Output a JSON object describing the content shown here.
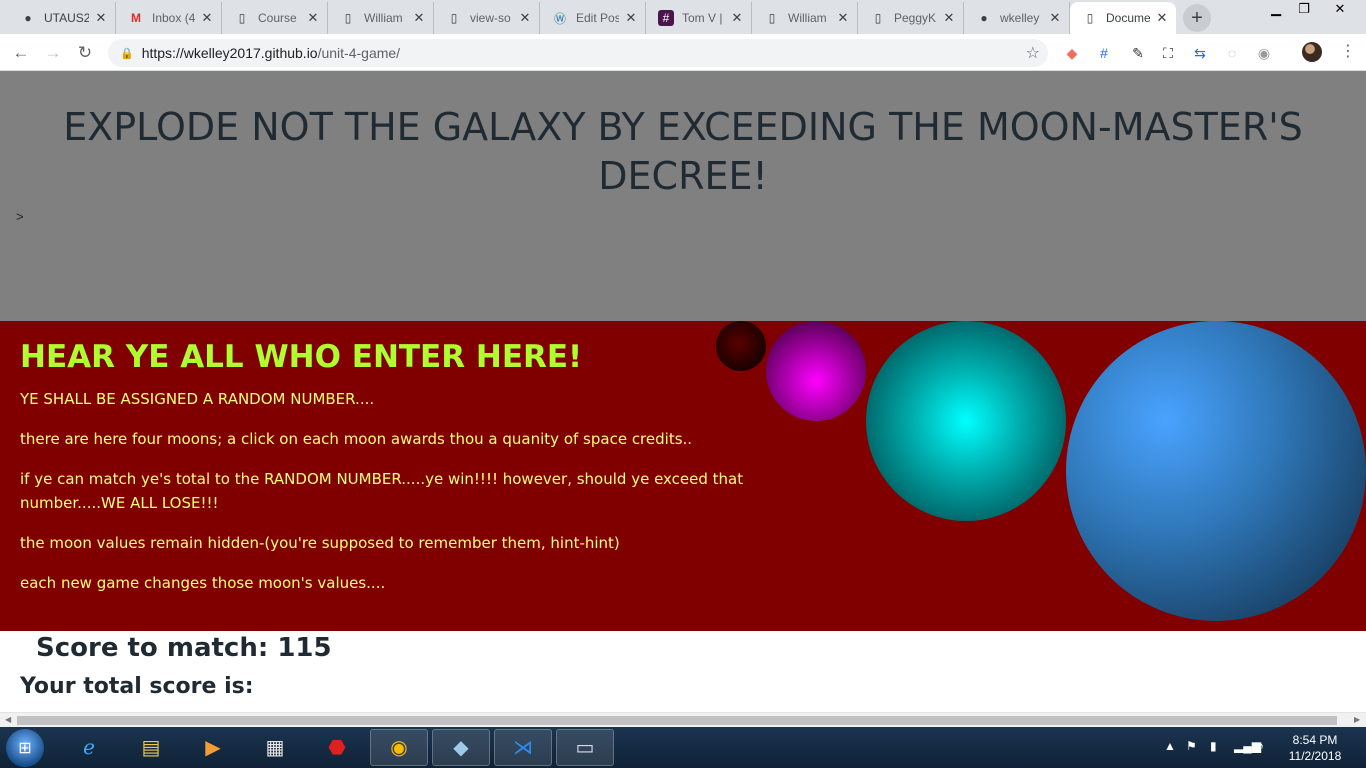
{
  "browser": {
    "tabs": [
      {
        "title": "UTAUS2",
        "icon": "github-icon"
      },
      {
        "title": "Inbox (4",
        "icon": "gmail-icon"
      },
      {
        "title": "Course",
        "icon": "page-icon"
      },
      {
        "title": "William",
        "icon": "page-icon"
      },
      {
        "title": "view-so",
        "icon": "page-icon"
      },
      {
        "title": "Edit Pos",
        "icon": "wordpress-icon"
      },
      {
        "title": "Tom V |",
        "icon": "slack-icon"
      },
      {
        "title": "William",
        "icon": "page-icon"
      },
      {
        "title": "PeggyK",
        "icon": "page-icon"
      },
      {
        "title": "wkelley",
        "icon": "github-icon"
      },
      {
        "title": "Docume",
        "icon": "page-icon",
        "active": true
      }
    ],
    "url_host": "https://wkelley2017.github.io",
    "url_path": "/unit-4-game/"
  },
  "page": {
    "title": "EXPLODE NOT THE GALAXY BY EXCEEDING THE MOON-MASTER'S DECREE!",
    "stray_char": ">",
    "heading": "HEAR YE ALL WHO ENTER HERE!",
    "rules": [
      "YE SHALL BE ASSIGNED A RANDOM NUMBER....",
      "there are here four moons; a click on each moon awards thou a quanity of space credits..",
      "if ye can match ye's total to the RANDOM NUMBER.....ye win!!!! however, should ye exceed that number.....WE ALL LOSE!!!",
      "the moon values remain hidden-(you're supposed to remember them, hint-hint)",
      "each new game changes those moon's values...."
    ],
    "score_label": "Score to match:",
    "score_value": "115",
    "total_label": "Your total score is:",
    "colors": {
      "header_band": "#808080",
      "instructions_band": "#800000",
      "heading_color": "#adff2f",
      "rule_color": "#ffff7a"
    }
  },
  "taskbar": {
    "time": "8:54 PM",
    "date": "11/2/2018"
  }
}
